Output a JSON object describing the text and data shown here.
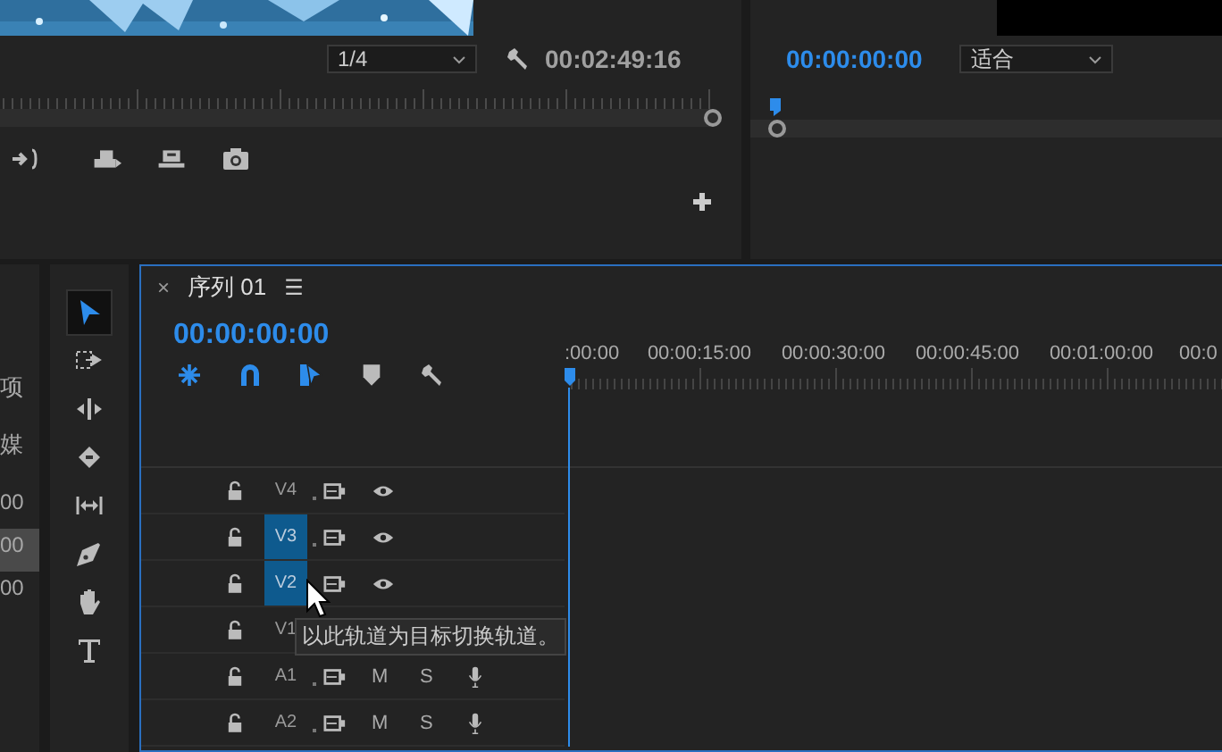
{
  "source_monitor": {
    "zoom": "1/4",
    "timecode": "00:02:49:16"
  },
  "program_monitor": {
    "timecode": "00:00:00:00",
    "zoom": "适合"
  },
  "project_panel": {
    "labels": [
      "项",
      "媒"
    ],
    "rows": [
      {
        "text": "00",
        "selected": false
      },
      {
        "text": "00",
        "selected": true
      },
      {
        "text": "00",
        "selected": false
      }
    ]
  },
  "tools": [
    {
      "kind": "selection",
      "selected": true
    },
    {
      "kind": "track-select",
      "selected": false
    },
    {
      "kind": "ripple",
      "selected": false
    },
    {
      "kind": "razor",
      "selected": false
    },
    {
      "kind": "slip",
      "selected": false
    },
    {
      "kind": "pen",
      "selected": false
    },
    {
      "kind": "hand",
      "selected": false
    },
    {
      "kind": "type",
      "selected": false
    }
  ],
  "timeline": {
    "close": "×",
    "title": "序列 01",
    "menu": "☰",
    "timecode": "00:00:00:00",
    "ruler_labels": [
      ":00:00",
      "00:00:15:00",
      "00:00:30:00",
      "00:00:45:00",
      "00:01:00:00",
      "00:0"
    ],
    "tracks": [
      {
        "name": "V4",
        "kind": "video",
        "targeted": false
      },
      {
        "name": "V3",
        "kind": "video",
        "targeted": true
      },
      {
        "name": "V2",
        "kind": "video",
        "targeted": true
      },
      {
        "name": "V1",
        "kind": "covered",
        "targeted": false
      },
      {
        "name": "A1",
        "kind": "audio",
        "targeted": false,
        "mute": "M",
        "solo": "S"
      },
      {
        "name": "A2",
        "kind": "audio",
        "targeted": false,
        "mute": "M",
        "solo": "S"
      }
    ],
    "tooltip": "以此轨道为目标切换轨道。"
  }
}
